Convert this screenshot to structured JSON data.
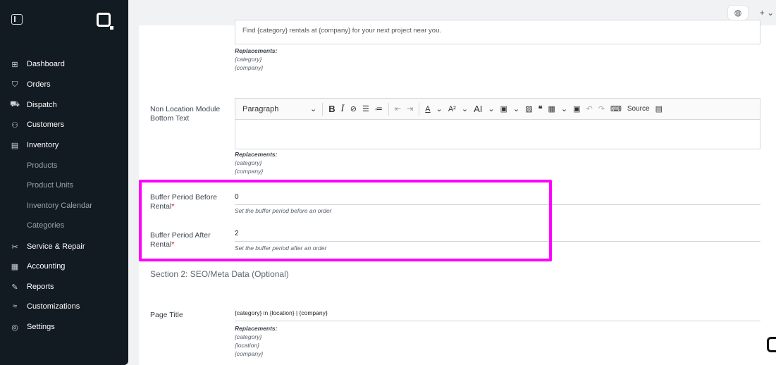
{
  "sidebar": {
    "toggle_icon": "sidebar-toggle-icon",
    "logo_icon": "app-logo-icon",
    "items": [
      {
        "label": "Dashboard",
        "icon": "dashboard-icon",
        "glyph": "⊞"
      },
      {
        "label": "Orders",
        "icon": "bag-icon",
        "glyph": "⛉"
      },
      {
        "label": "Dispatch",
        "icon": "truck-icon",
        "glyph": "⛟"
      },
      {
        "label": "Customers",
        "icon": "users-icon",
        "glyph": "⚇"
      },
      {
        "label": "Inventory",
        "icon": "inventory-icon",
        "glyph": "▤"
      }
    ],
    "inventory_sub": [
      "Products",
      "Product Units",
      "Inventory Calendar",
      "Categories"
    ],
    "items_after": [
      {
        "label": "Service & Repair",
        "icon": "tools-icon",
        "glyph": "✂"
      },
      {
        "label": "Accounting",
        "icon": "calculator-icon",
        "glyph": "▦"
      },
      {
        "label": "Reports",
        "icon": "reports-icon",
        "glyph": "✎"
      },
      {
        "label": "Customizations",
        "icon": "customize-icon",
        "glyph": "≈"
      },
      {
        "label": "Settings",
        "icon": "gear-icon",
        "glyph": "◎"
      }
    ]
  },
  "topbar": {
    "palette_icon": "palette-icon",
    "plus_label": "+ ⌄"
  },
  "form": {
    "top_textarea_text": "Find {category} rentals at {company} for your next project near you.",
    "replacements_title": "Replacements:",
    "top_replacements": [
      "{category}",
      "{company}"
    ],
    "non_location_label": "Non Location Module Bottom Text",
    "toolbar": {
      "paragraph": "Paragraph",
      "source": "Source"
    },
    "non_location_replacements": [
      "{category}",
      "{company}"
    ],
    "buffer_before_label": "Buffer Period Before Rental",
    "buffer_before_value": "0",
    "buffer_before_hint": "Set the buffer period before an order",
    "buffer_after_label": "Buffer Period After Rental",
    "buffer_after_value": "2",
    "buffer_after_hint": "Set the buffer period after an order",
    "required_mark": "*",
    "section2_title": "Section 2: SEO/Meta Data (Optional)",
    "page_title_label": "Page Title",
    "page_title_value": "{category} in {location} | {company}",
    "page_title_replacements": [
      "{category}",
      "{location}",
      "{company}"
    ]
  },
  "colors": {
    "highlight": "#ff00ff",
    "sidebar_bg": "#121a22"
  }
}
